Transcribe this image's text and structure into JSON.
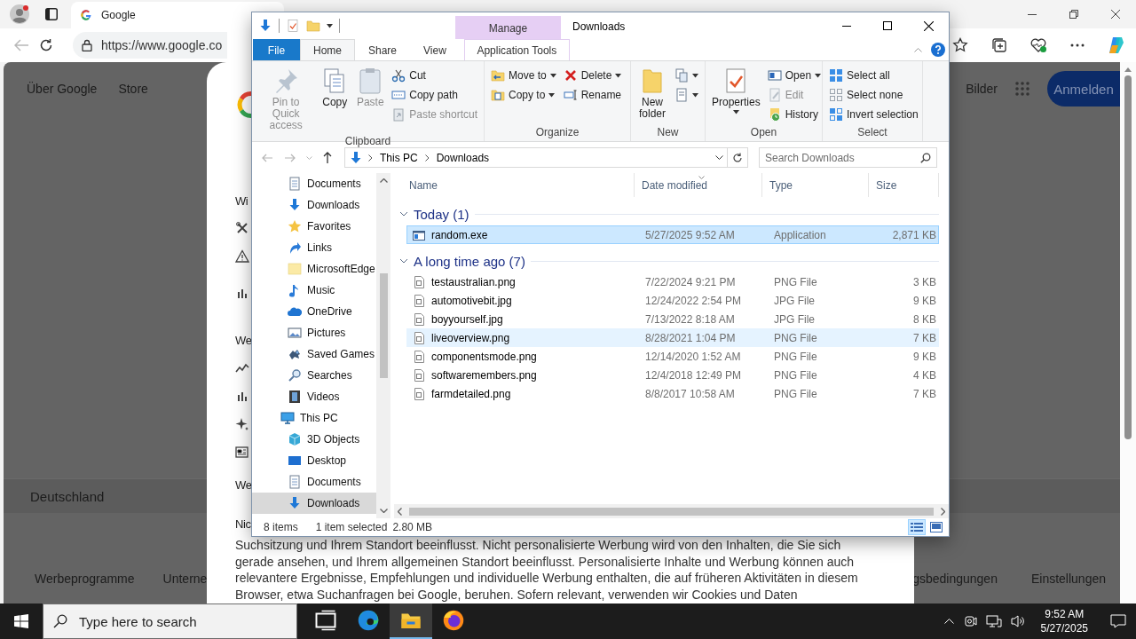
{
  "browser": {
    "tab": {
      "title": "Google"
    },
    "address": "https://www.google.co",
    "page": {
      "header_links": [
        "Über Google",
        "Store"
      ],
      "images_link": "Bilder",
      "sign_in": "Anmelden",
      "country": "Deutschland",
      "footer_left": [
        "Werbeprogramme",
        "Unterne"
      ],
      "footer_right": [
        "gsbedingungen",
        "Einstellungen"
      ],
      "dialog": {
        "items": [
          {
            "kind": "heading",
            "text": "Wi"
          },
          {
            "kind": "tools"
          },
          {
            "kind": "warning"
          },
          {
            "kind": "stats"
          },
          {
            "kind": "heading",
            "text": "We"
          },
          {
            "kind": "trend"
          },
          {
            "kind": "stats"
          },
          {
            "kind": "sparkle"
          },
          {
            "kind": "news"
          },
          {
            "kind": "heading",
            "text": "We"
          },
          {
            "kind": "heading",
            "text": "Nic"
          }
        ],
        "paragraph": "Suchsitzung und Ihrem Standort beeinflusst. Nicht personalisierte Werbung wird von den Inhalten, die Sie sich gerade ansehen, und Ihrem allgemeinen Standort beeinflusst. Personalisierte Inhalte und Werbung können auch relevantere Ergebnisse, Empfehlungen und individuelle Werbung enthalten, die auf früheren Aktivitäten in diesem Browser, etwa Suchanfragen bei Google, beruhen. Sofern relevant, verwenden wir Cookies und Daten"
      }
    }
  },
  "explorer": {
    "title": "Downloads",
    "context_header": "Manage",
    "tabs": [
      {
        "label": "File",
        "kind": "file",
        "selected": false
      },
      {
        "label": "Home",
        "kind": "tab",
        "selected": true
      },
      {
        "label": "Share",
        "kind": "tab",
        "selected": false
      },
      {
        "label": "View",
        "kind": "tab",
        "selected": false
      },
      {
        "label": "Application Tools",
        "kind": "context",
        "selected": false
      }
    ],
    "ribbon": [
      {
        "label": "Clipboard",
        "columns": [
          [
            {
              "kind": "pin",
              "label": "Pin to Quick access",
              "disabled": true
            }
          ],
          [
            {
              "kind": "copy",
              "label": "Copy",
              "disabled": false
            }
          ],
          [
            {
              "kind": "paste",
              "label": "Paste",
              "disabled": true
            }
          ],
          [
            {
              "kind": "cut",
              "label": "Cut",
              "disabled": false
            },
            {
              "kind": "copypath",
              "label": "Copy path",
              "disabled": false
            },
            {
              "kind": "pasteshortcut",
              "label": "Paste shortcut",
              "disabled": true
            }
          ]
        ]
      },
      {
        "label": "Organize",
        "columns": [
          [
            {
              "kind": "move",
              "label": "Move to",
              "menu": true
            },
            {
              "kind": "copyto",
              "label": "Copy to",
              "menu": true
            }
          ],
          [
            {
              "kind": "delete",
              "label": "Delete",
              "menu": true
            },
            {
              "kind": "rename",
              "label": "Rename"
            }
          ]
        ]
      },
      {
        "label": "New",
        "columns": [
          [
            {
              "kind": "newfolder",
              "label": "New folder"
            }
          ],
          [
            {
              "kind": "newitem",
              "menu": true
            },
            {
              "kind": "easyaccess",
              "menu": true
            }
          ]
        ]
      },
      {
        "label": "Open",
        "columns": [
          [
            {
              "kind": "properties",
              "label": "Properties",
              "menu": true
            }
          ],
          [
            {
              "kind": "open",
              "label": "Open",
              "menu": true,
              "disabled": false
            },
            {
              "kind": "edit",
              "label": "Edit",
              "disabled": true
            },
            {
              "kind": "history",
              "label": "History",
              "disabled": false
            }
          ]
        ]
      },
      {
        "label": "Select",
        "columns": [
          [
            {
              "kind": "selectall",
              "label": "Select all"
            },
            {
              "kind": "selectnone",
              "label": "Select none"
            },
            {
              "kind": "invert",
              "label": "Invert selection"
            }
          ]
        ]
      }
    ],
    "address": {
      "path": [
        "This PC",
        "Downloads"
      ],
      "search_placeholder": "Search Downloads"
    },
    "navigation": [
      {
        "children": [
          {
            "label": "Documents",
            "kind": "documents",
            "selected": false
          },
          {
            "label": "Downloads",
            "kind": "downloads",
            "selected": false
          },
          {
            "label": "Favorites",
            "kind": "favorites",
            "selected": false
          },
          {
            "label": "Links",
            "kind": "links",
            "selected": false
          },
          {
            "label": "MicrosoftEdge",
            "kind": "folder",
            "selected": false
          },
          {
            "label": "Music",
            "kind": "music",
            "selected": false
          },
          {
            "label": "OneDrive",
            "kind": "cloud",
            "selected": false
          },
          {
            "label": "Pictures",
            "kind": "pictures",
            "selected": false
          },
          {
            "label": "Saved Games",
            "kind": "games",
            "selected": false
          },
          {
            "label": "Searches",
            "kind": "searches",
            "selected": false
          },
          {
            "label": "Videos",
            "kind": "videos",
            "selected": false
          }
        ]
      },
      {
        "label": "This PC",
        "kind": "pc",
        "selected": false,
        "children": [
          {
            "label": "3D Objects",
            "kind": "objects",
            "selected": false
          },
          {
            "label": "Desktop",
            "kind": "desktop",
            "selected": false
          },
          {
            "label": "Documents",
            "kind": "documents",
            "selected": false
          },
          {
            "label": "Downloads",
            "kind": "downloads",
            "selected": true
          }
        ]
      }
    ],
    "columns": [
      {
        "label": "Name",
        "sorted": false
      },
      {
        "label": "Date modified",
        "sorted": true
      },
      {
        "label": "Type",
        "sorted": false
      },
      {
        "label": "Size",
        "sorted": false
      }
    ],
    "groups": [
      {
        "label": "Today (1)",
        "expanded": true,
        "files": [
          {
            "name": "random.exe",
            "kind": "application",
            "date": "5/27/2025 9:52 AM",
            "type": "Application",
            "size": "2,871 KB",
            "selected": true,
            "hovered": false
          }
        ]
      },
      {
        "label": "A long time ago (7)",
        "expanded": true,
        "files": [
          {
            "name": "testaustralian.png",
            "kind": "image",
            "date": "7/22/2024 9:21 PM",
            "type": "PNG File",
            "size": "3 KB",
            "selected": false,
            "hovered": false
          },
          {
            "name": "automotivebit.jpg",
            "kind": "image",
            "date": "12/24/2022 2:54 PM",
            "type": "JPG File",
            "size": "9 KB",
            "selected": false,
            "hovered": false
          },
          {
            "name": "boyyourself.jpg",
            "kind": "image",
            "date": "7/13/2022 8:18 AM",
            "type": "JPG File",
            "size": "8 KB",
            "selected": false,
            "hovered": false
          },
          {
            "name": "liveoverview.png",
            "kind": "image",
            "date": "8/28/2021 1:04 PM",
            "type": "PNG File",
            "size": "7 KB",
            "selected": false,
            "hovered": true
          },
          {
            "name": "componentsmode.png",
            "kind": "image",
            "date": "12/14/2020 1:52 AM",
            "type": "PNG File",
            "size": "9 KB",
            "selected": false,
            "hovered": false
          },
          {
            "name": "softwaremembers.png",
            "kind": "image",
            "date": "12/4/2018 12:49 PM",
            "type": "PNG File",
            "size": "4 KB",
            "selected": false,
            "hovered": false
          },
          {
            "name": "farmdetailed.png",
            "kind": "image",
            "date": "8/8/2017 10:58 AM",
            "type": "PNG File",
            "size": "7 KB",
            "selected": false,
            "hovered": false
          }
        ]
      }
    ],
    "status": {
      "count": "8 items",
      "selection": "1 item selected",
      "size": "2.80 MB"
    },
    "views": [
      {
        "kind": "details",
        "selected": true
      },
      {
        "kind": "tiles",
        "selected": false
      }
    ]
  },
  "taskbar": {
    "search_placeholder": "Type here to search",
    "apps": [
      {
        "kind": "taskview",
        "selected": false
      },
      {
        "kind": "edge",
        "selected": false
      },
      {
        "kind": "explorer",
        "selected": true
      },
      {
        "kind": "firefox",
        "selected": false
      }
    ],
    "time": "9:52 AM",
    "date": "5/27/2025"
  }
}
